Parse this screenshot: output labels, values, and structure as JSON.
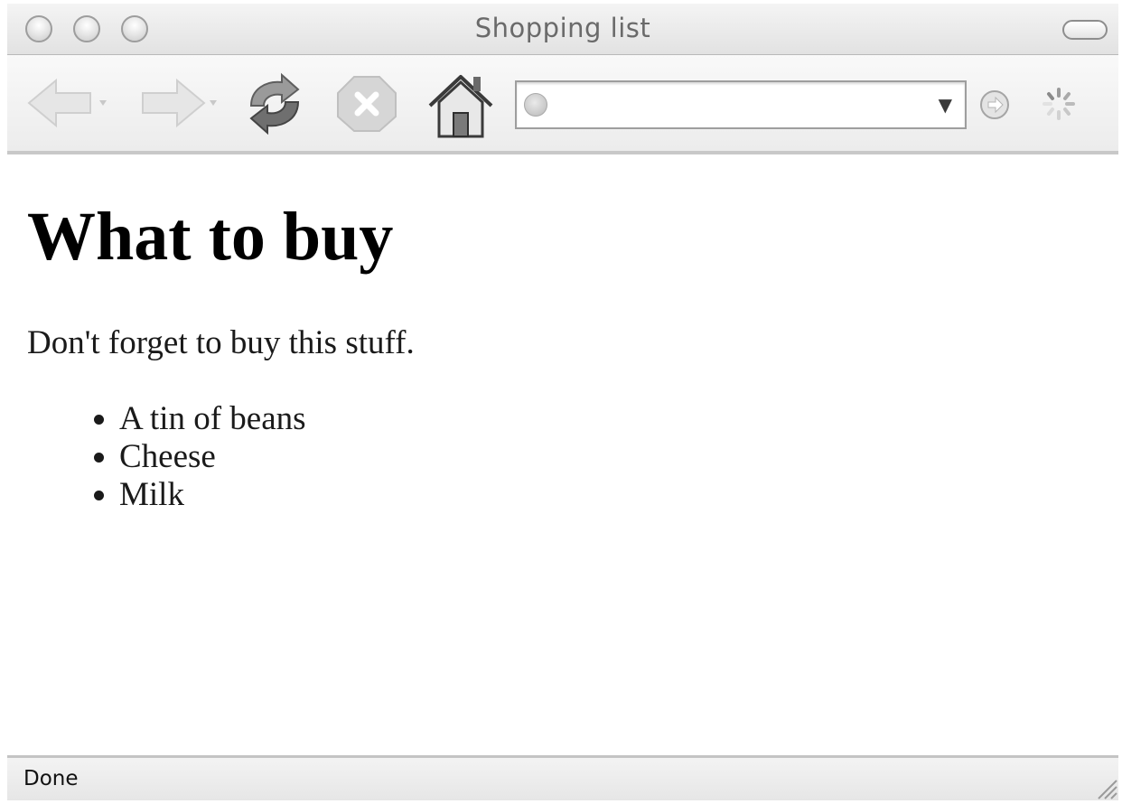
{
  "window": {
    "title": "Shopping list",
    "controls": [
      "close-button",
      "minimize-button",
      "zoom-button"
    ]
  },
  "toolbar": {
    "back_icon": "back-arrow-icon",
    "forward_icon": "forward-arrow-icon",
    "reload_icon": "reload-icon",
    "stop_icon": "stop-icon",
    "home_icon": "home-icon",
    "url": {
      "value": "",
      "placeholder": ""
    },
    "go_icon": "go-icon",
    "throbber_icon": "loading-spinner-icon"
  },
  "page": {
    "heading": "What to buy",
    "paragraph": "Don't forget to buy this stuff.",
    "items": [
      "A tin of beans",
      "Cheese",
      "Milk"
    ]
  },
  "status": {
    "text": "Done"
  },
  "colors": {
    "chrome_light": "#f4f4f4",
    "chrome_dark": "#e2e2e2",
    "title_text": "#6a6a6a",
    "content_bg": "#ffffff"
  }
}
